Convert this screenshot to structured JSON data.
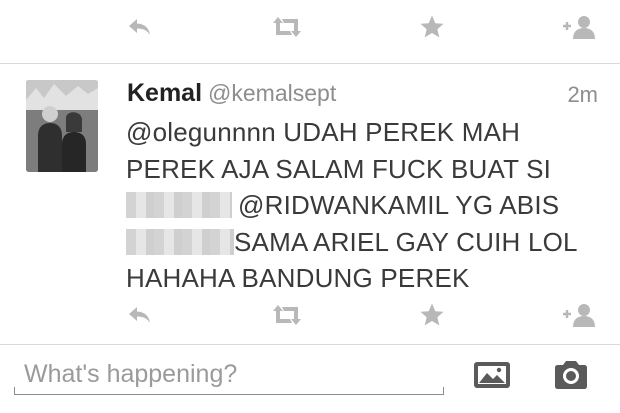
{
  "colors": {
    "icon": "#b8b8b8",
    "tool_icon": "#5a5a5a",
    "separator": "#d9d9d9",
    "name": "#222222",
    "muted": "#8d8d8d"
  },
  "actions": {
    "reply_icon": "reply-icon",
    "retweet_icon": "retweet-icon",
    "favorite_icon": "star-icon",
    "follow_icon": "add-user-icon"
  },
  "tweet": {
    "name": "Kemal",
    "handle": "@kemalsept",
    "time": "2m",
    "lines": [
      "@olegunnnn UDAH PEREK MAH",
      "PEREK AJA SALAM FUCK BUAT SI",
      "@RIDWANKAMIL YG ABIS",
      "SAMA ARIEL GAY CUIH LOL",
      "HAHAHA BANDUNG PEREK"
    ]
  },
  "composer": {
    "placeholder": "What's happening?",
    "value": "",
    "photo_icon": "image-icon",
    "camera_icon": "camera-icon"
  }
}
